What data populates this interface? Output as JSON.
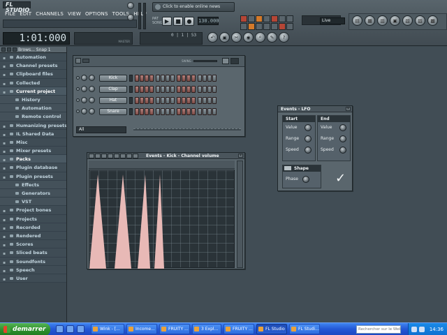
{
  "app": {
    "logo": "FL STUDIO",
    "menu": [
      "FILE",
      "EDIT",
      "CHANNELS",
      "VIEW",
      "OPTIONS",
      "TOOLS",
      "HELP"
    ],
    "online_news": "Click to enable online news",
    "tempo": "130.000",
    "output": "Live",
    "time": "1:01:000",
    "song_position": "0 | 1 | 53",
    "master_labels": "MASTER"
  },
  "browser": {
    "title": "Brows... Snap 1",
    "items": [
      {
        "label": "Automation",
        "level": 0
      },
      {
        "label": "Channel presets",
        "level": 0
      },
      {
        "label": "Clipboard files",
        "level": 0
      },
      {
        "label": "Collected",
        "level": 0
      },
      {
        "label": "Current project",
        "level": 0,
        "selected": true
      },
      {
        "label": "History",
        "level": 1
      },
      {
        "label": "Automation",
        "level": 1
      },
      {
        "label": "Remote control",
        "level": 1
      },
      {
        "label": "Humanizing presets",
        "level": 0
      },
      {
        "label": "IL Shared Data",
        "level": 0
      },
      {
        "label": "Misc",
        "level": 0
      },
      {
        "label": "Mixer presets",
        "level": 0
      },
      {
        "label": "Packs",
        "level": 0,
        "selected": true
      },
      {
        "label": "Plugin database",
        "level": 0
      },
      {
        "label": "Plugin presets",
        "level": 0
      },
      {
        "label": "Effects",
        "level": 1
      },
      {
        "label": "Generators",
        "level": 1
      },
      {
        "label": "VST",
        "level": 1
      },
      {
        "label": "Project bones",
        "level": 0
      },
      {
        "label": "Projects",
        "level": 0
      },
      {
        "label": "Recorded",
        "level": 0
      },
      {
        "label": "Rendered",
        "level": 0
      },
      {
        "label": "Scores",
        "level": 0
      },
      {
        "label": "Sliced beats",
        "level": 0
      },
      {
        "label": "Soundfonts",
        "level": 0
      },
      {
        "label": "Speech",
        "level": 0
      },
      {
        "label": "User",
        "level": 0
      }
    ]
  },
  "step_sequencer": {
    "swing_label": "SWING",
    "channels": [
      {
        "name": "Kick",
        "steps": "a a a a b b b b a a a a b b b b"
      },
      {
        "name": "Clap",
        "steps": "a a a a b b b b a a a a b b b b"
      },
      {
        "name": "Hat",
        "steps": "a a a a b b b b a a a a b b b b"
      },
      {
        "name": "Snare",
        "steps": "a a a a b b b b a a a a b b b b"
      }
    ],
    "filter": "All"
  },
  "events_kick": {
    "title": "Events - Kick - Channel volume"
  },
  "events_lfo": {
    "title": "Events - LFO",
    "start": {
      "title": "Start",
      "params": [
        "Value",
        "Range",
        "Speed"
      ]
    },
    "end": {
      "title": "End",
      "params": [
        "Value",
        "Range",
        "Speed"
      ]
    },
    "shape_label": "Shape",
    "phase_label": "Phase",
    "accept": "✓"
  },
  "taskbar": {
    "start": "demarrer",
    "tasks": [
      {
        "label": "Wink - [..."
      },
      {
        "label": "Income..."
      },
      {
        "label": "FRUITY ..."
      },
      {
        "label": "3 Expl..."
      },
      {
        "label": "FRUITY ..."
      },
      {
        "label": "FL Studio",
        "active": true
      },
      {
        "label": "FL Studi..."
      }
    ],
    "search_placeholder": "Rechercher sur le Web",
    "clock": "14:36"
  }
}
